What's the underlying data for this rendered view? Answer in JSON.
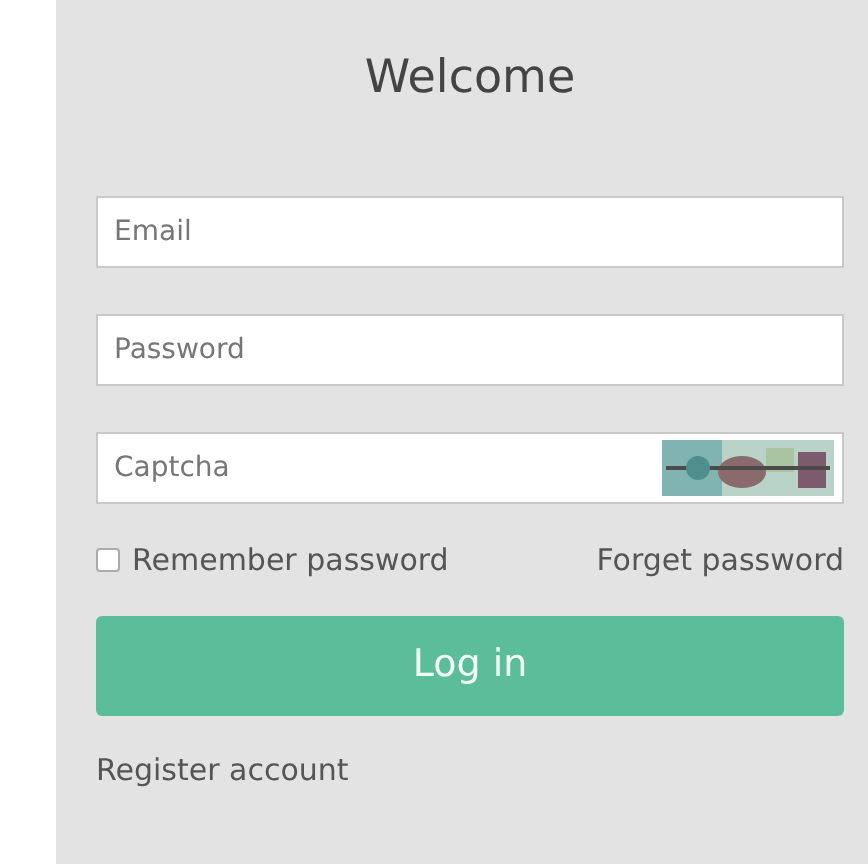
{
  "title": "Welcome",
  "fields": [
    {
      "placeholder": "Email"
    },
    {
      "placeholder": "Password"
    },
    {
      "placeholder": "Captcha"
    }
  ],
  "remember": {
    "label": "Remember password",
    "checked": false
  },
  "forget_link": "Forget password",
  "login_button": "Log in",
  "register_link": "Register account"
}
